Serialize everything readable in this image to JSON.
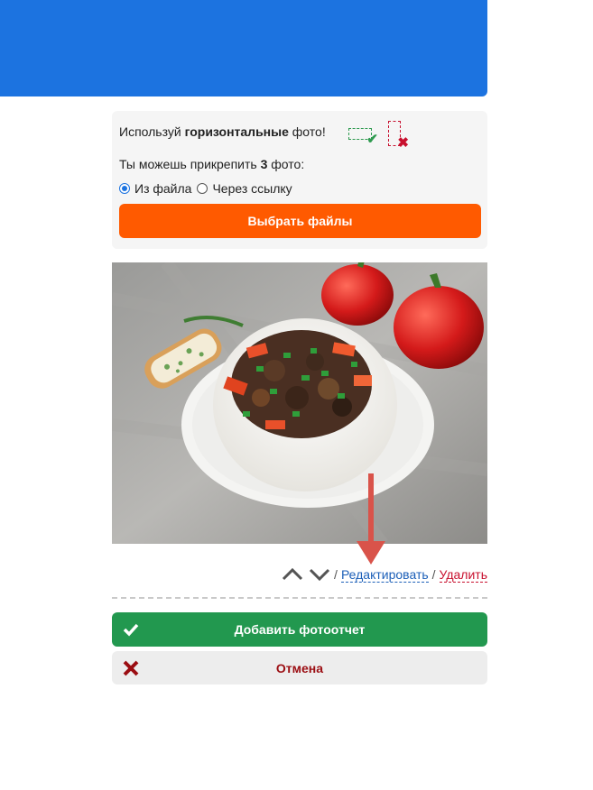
{
  "hint": {
    "prefix": "Используй ",
    "emphasis": "горизонтальные",
    "suffix": " фото!"
  },
  "photo_count": {
    "prefix": "Ты можешь прикрепить ",
    "count": "3",
    "suffix": " фото:"
  },
  "source": {
    "options": [
      {
        "label": "Из файла",
        "selected": true
      },
      {
        "label": "Через ссылку",
        "selected": false
      }
    ]
  },
  "choose_files_label": "Выбрать файлы",
  "photo_controls": {
    "separator": "/",
    "edit_label": "Редактировать",
    "delete_label": "Удалить"
  },
  "submit_label": "Добавить фотоотчет",
  "cancel_label": "Отмена",
  "colors": {
    "banner": "#1c73e0",
    "choose_button": "#ff5a00",
    "submit_button": "#22984f",
    "cancel_text": "#9b0d12",
    "annotation_arrow": "#d9534a"
  },
  "icons": {
    "move_up": "chevron-up-icon",
    "move_down": "chevron-down-icon",
    "submit": "check-icon",
    "cancel": "cross-icon",
    "horizontal_ok": "check-icon",
    "vertical_bad": "cross-icon"
  }
}
